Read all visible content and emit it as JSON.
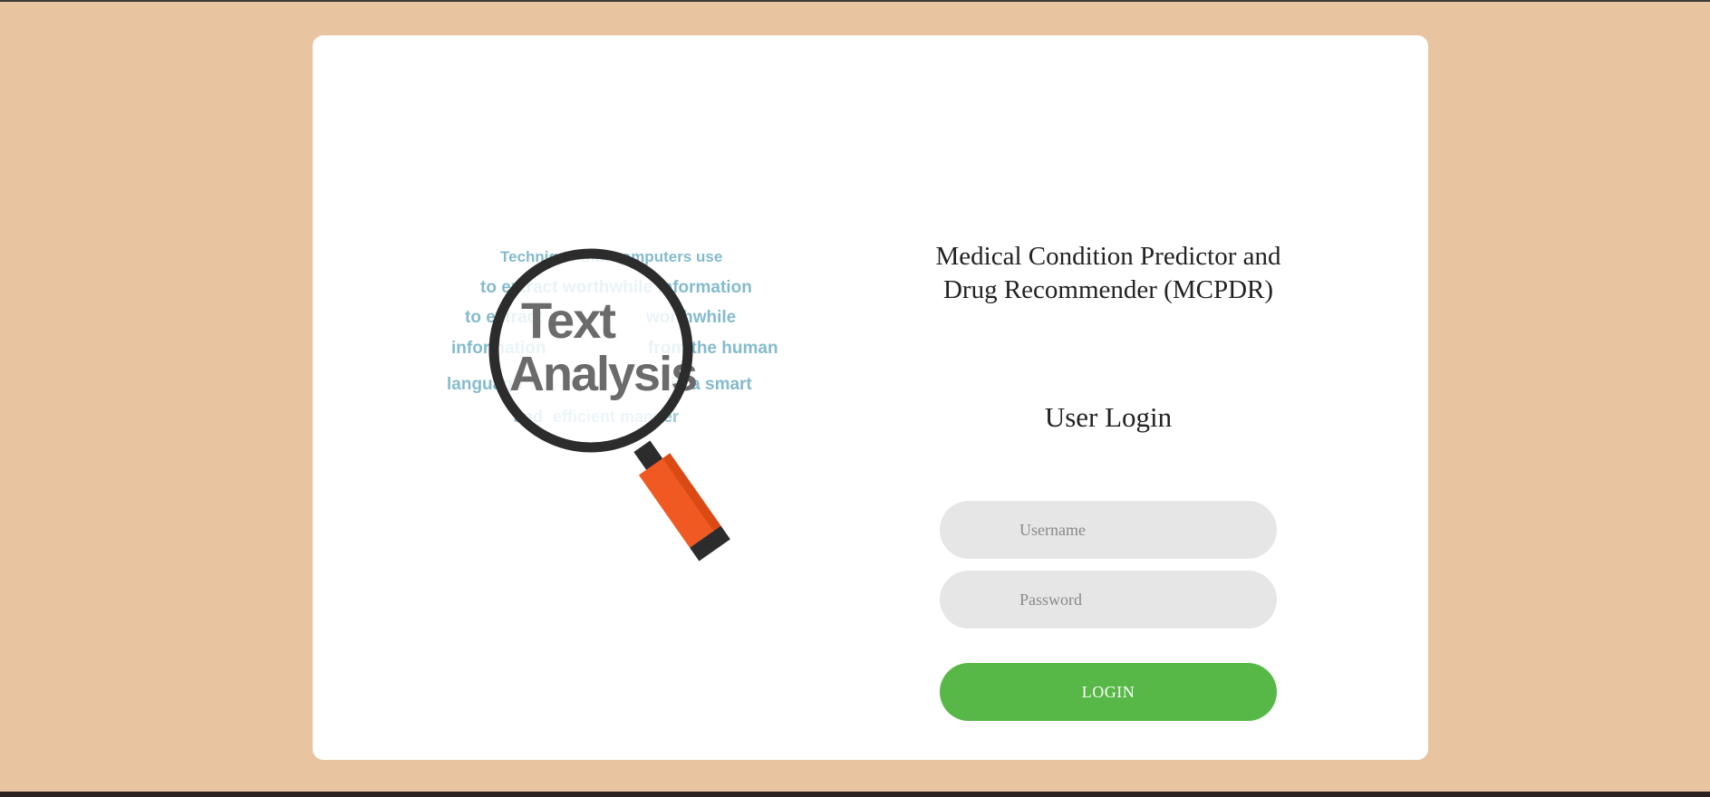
{
  "app": {
    "title": "Medical Condition Predictor and Drug Recommender (MCPDR)"
  },
  "login": {
    "heading": "User Login",
    "username_placeholder": "Username",
    "password_placeholder": "Password",
    "button_label": "LOGIN"
  },
  "illustration": {
    "icon": "magnifying-glass-icon",
    "word_cloud": [
      "Technique that computers use",
      "to extract worthwhile information",
      "to extract",
      "worthwhile",
      "information",
      "from the human",
      "language",
      "in a smart",
      "and",
      "efficient manner",
      "Text",
      "Analysis"
    ],
    "colors": {
      "text_light": "#6fb0c4",
      "text_dark": "#6b6b6b",
      "lens_rim": "#2c2c2c",
      "handle": "#f05a22"
    }
  },
  "colors": {
    "background": "#e8c5a0",
    "card": "#ffffff",
    "input_bg": "#e6e6e6",
    "button": "#57b847"
  }
}
